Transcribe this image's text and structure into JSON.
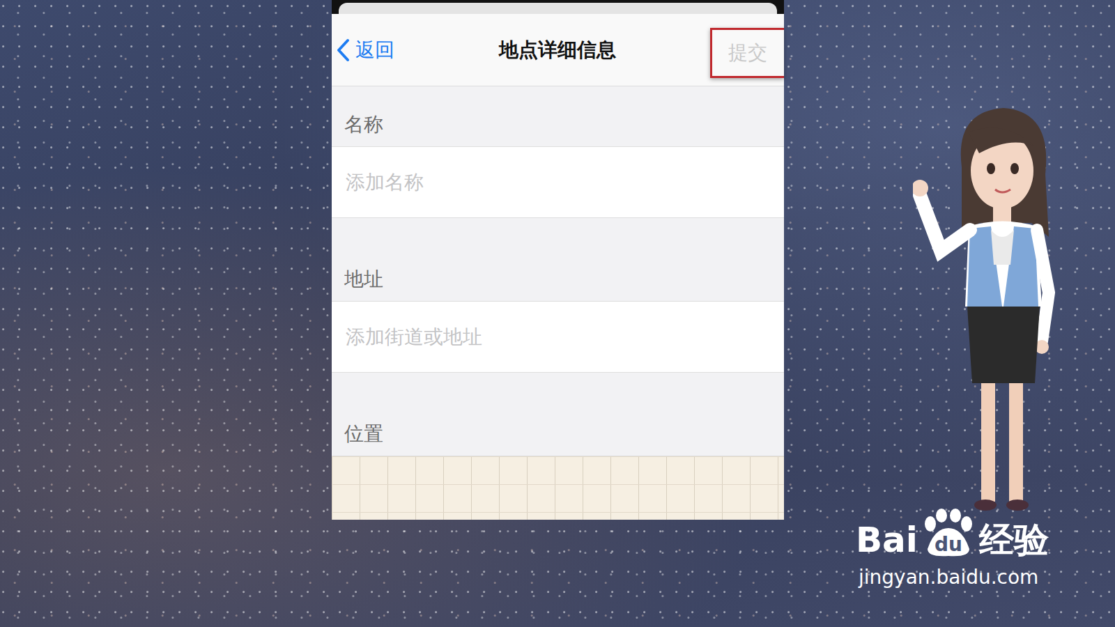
{
  "nav": {
    "back": "返回",
    "title": "地点详细信息",
    "submit": {
      "label": "提交",
      "disabled": true,
      "highlighted": true
    }
  },
  "sections": [
    {
      "header": "名称",
      "kind": "field",
      "placeholder": "添加名称"
    },
    {
      "header": "地址",
      "kind": "field",
      "placeholder": "添加街道或地址"
    },
    {
      "header": "位置",
      "kind": "map"
    }
  ],
  "watermark": {
    "brand_left": "Bai",
    "brand_paw": "du",
    "brand_right": "经验",
    "url": "jingyan.baidu.com"
  }
}
